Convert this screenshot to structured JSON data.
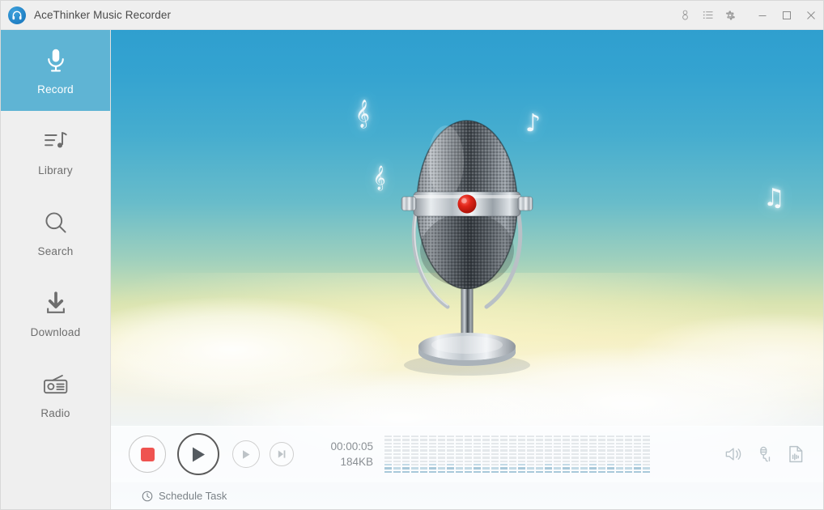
{
  "window": {
    "title": "AceThinker Music Recorder",
    "logo_icon": "headphones-icon",
    "toolbar_icons": [
      {
        "name": "account-icon",
        "glyph": "account"
      },
      {
        "name": "list-icon",
        "glyph": "list"
      },
      {
        "name": "gear-icon",
        "glyph": "gear"
      }
    ],
    "system_buttons": [
      {
        "name": "minimize-button",
        "glyph": "minimize"
      },
      {
        "name": "maximize-button",
        "glyph": "maximize"
      },
      {
        "name": "close-button",
        "glyph": "close"
      }
    ]
  },
  "sidebar": {
    "active_index": 0,
    "active_color": "#5fb4d4",
    "items": [
      {
        "label": "Record",
        "icon": "microphone-icon"
      },
      {
        "label": "Library",
        "icon": "music-list-icon"
      },
      {
        "label": "Search",
        "icon": "magnifier-icon"
      },
      {
        "label": "Download",
        "icon": "download-arrow-icon"
      },
      {
        "label": "Radio",
        "icon": "radio-icon"
      }
    ]
  },
  "stage": {
    "artwork": "vintage-microphone-illustration",
    "record_indicator_color": "#d81f1f",
    "background": "sky-gradient-with-clouds",
    "decorations": [
      {
        "name": "treble-clef-note",
        "glyph": "𝄞"
      },
      {
        "name": "eighth-note",
        "glyph": "♪"
      },
      {
        "name": "beamed-notes",
        "glyph": "♫"
      }
    ]
  },
  "controls": {
    "stop": {
      "label": "Stop",
      "icon": "stop-icon",
      "enabled": true
    },
    "play": {
      "label": "Play",
      "icon": "play-icon",
      "enabled": true
    },
    "play_alt": {
      "label": "Play",
      "icon": "play-small-icon",
      "enabled": false
    },
    "next": {
      "label": "Next",
      "icon": "skip-forward-icon",
      "enabled": false
    },
    "elapsed": "00:00:05",
    "filesize": "184KB",
    "visualizer": {
      "bars": 30,
      "segments_per_bar": 11,
      "active_levels": [
        3,
        2,
        3,
        2,
        2,
        3,
        2,
        3,
        2,
        2,
        3,
        2,
        2,
        3,
        2,
        3,
        2,
        2,
        3,
        2,
        3,
        2,
        2,
        3,
        2,
        3,
        2,
        2,
        3,
        2
      ],
      "idle_color": "#e4e8eb",
      "active_color": "#a9c9da"
    },
    "output_icons": [
      {
        "name": "speaker-icon",
        "label": "System Sound"
      },
      {
        "name": "microphone-input-icon",
        "label": "Microphone"
      },
      {
        "name": "audio-file-icon",
        "label": "Output File"
      }
    ]
  },
  "statusbar": {
    "schedule_label": "Schedule Task",
    "schedule_icon": "clock-icon"
  }
}
